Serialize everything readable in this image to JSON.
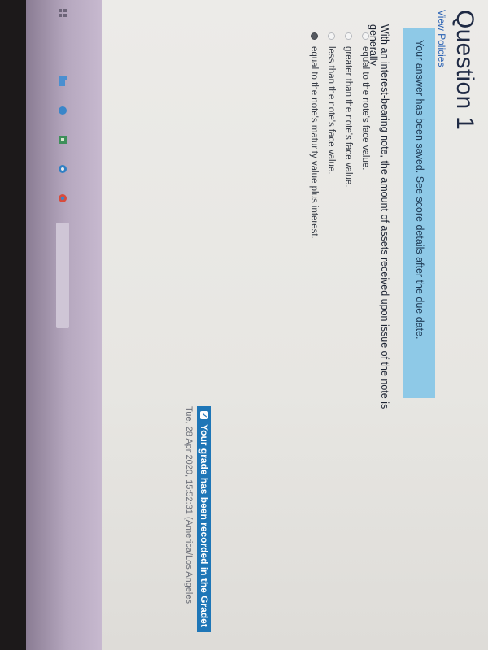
{
  "question": {
    "title": "Question 1",
    "view_policies": "View Policies",
    "saved_message": "Your answer has been saved. See score details after the due date.",
    "prompt": "With an interest-bearing note, the amount of assets received upon issue of the note is generally",
    "options": [
      {
        "label": "equal to the note's face value.",
        "selected": false
      },
      {
        "label": "greater than the note's face value.",
        "selected": false
      },
      {
        "label": "less than the note's face value.",
        "selected": false
      },
      {
        "label": "equal to the note's maturity value plus interest.",
        "selected": true
      }
    ]
  },
  "status": {
    "grade_recorded": "Your grade has been recorded in the Gradet",
    "timestamp": "Tue, 28 Apr 2020, 15:52:31 (America/Los Angeles"
  },
  "colors": {
    "banner": "#8ec9e7",
    "grade_badge": "#1e76b7",
    "taskbar": "#b6a8bf",
    "title": "#1f2a44",
    "link": "#2a62b4"
  },
  "taskbar": {
    "icons": [
      "grid-icon",
      "folder-icon",
      "globe-icon",
      "app-icon",
      "browser-icon",
      "chrome-icon"
    ],
    "search_placeholder": ""
  }
}
